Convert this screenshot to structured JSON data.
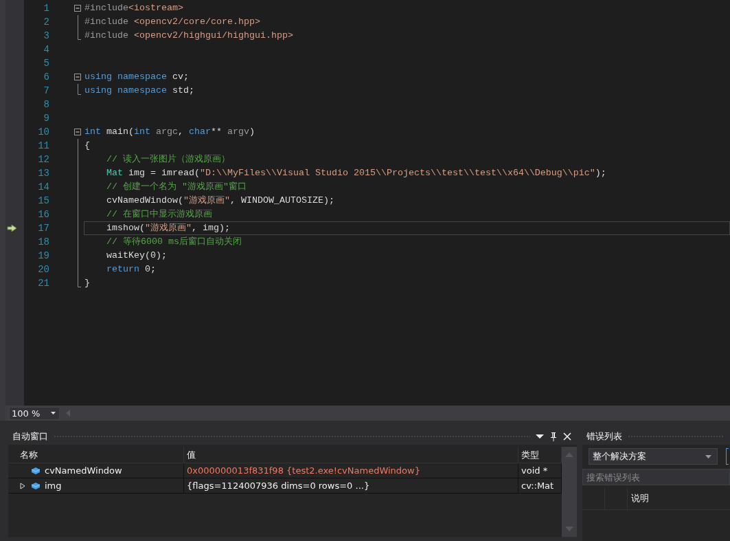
{
  "editor": {
    "lines": [
      {
        "number": "1",
        "kind": "fold_start",
        "current": false,
        "tokens": [
          {
            "kind": "pre",
            "text": "#include"
          },
          {
            "kind": "str",
            "text": "<iostream>"
          }
        ]
      },
      {
        "number": "2",
        "kind": "fold_body",
        "current": false,
        "tokens": [
          {
            "kind": "pre",
            "text": "#include"
          },
          {
            "kind": "str",
            "text": " <opencv2/core/core.hpp>"
          }
        ]
      },
      {
        "number": "3",
        "kind": "fold_end",
        "current": false,
        "tokens": [
          {
            "kind": "pre",
            "text": "#include"
          },
          {
            "kind": "str",
            "text": " <opencv2/highgui/highgui.hpp>"
          }
        ]
      },
      {
        "number": "4",
        "kind": "plain"
      },
      {
        "number": "5",
        "kind": "plain"
      },
      {
        "number": "6",
        "kind": "fold_start",
        "current": false,
        "tokens": [
          {
            "kind": "kw",
            "text": "using"
          },
          {
            "kind": "kw",
            "text": " namespace"
          },
          {
            "kind": "plain",
            "text": " cv;"
          }
        ]
      },
      {
        "number": "7",
        "kind": "fold_end",
        "current": false,
        "tokens": [
          {
            "kind": "kw",
            "text": "using"
          },
          {
            "kind": "kw",
            "text": " namespace"
          },
          {
            "kind": "plain",
            "text": " std;"
          }
        ]
      },
      {
        "number": "8",
        "kind": "plain"
      },
      {
        "number": "9",
        "kind": "plain"
      },
      {
        "number": "10",
        "kind": "fold_start",
        "current": false,
        "tokens": [
          {
            "kind": "kw",
            "text": "int"
          },
          {
            "kind": "plain",
            "text": " main("
          },
          {
            "kind": "kw",
            "text": "int"
          },
          {
            "kind": "param",
            "text": " argc"
          },
          {
            "kind": "plain",
            "text": ", "
          },
          {
            "kind": "kw",
            "text": "char"
          },
          {
            "kind": "plain",
            "text": "**"
          },
          {
            "kind": "param",
            "text": " argv"
          },
          {
            "kind": "plain",
            "text": ")"
          }
        ]
      },
      {
        "number": "11",
        "kind": "fold_body",
        "current": false,
        "tokens": [
          {
            "kind": "plain",
            "text": "{"
          }
        ]
      },
      {
        "number": "12",
        "kind": "fold_body",
        "current": false,
        "tokens": [
          {
            "kind": "cmt",
            "text": "    // 读入一张图片（游戏原画）"
          }
        ]
      },
      {
        "number": "13",
        "kind": "fold_body",
        "current": false,
        "tokens": [
          {
            "kind": "type",
            "text": "    Mat"
          },
          {
            "kind": "plain",
            "text": " img = imread("
          },
          {
            "kind": "str",
            "text": "\"D:\\\\MyFiles\\\\Visual Studio 2015\\\\Projects\\\\test\\\\test\\\\x64\\\\Debug\\\\pic\""
          },
          {
            "kind": "plain",
            "text": ");"
          }
        ]
      },
      {
        "number": "14",
        "kind": "fold_body",
        "current": false,
        "tokens": [
          {
            "kind": "cmt",
            "text": "    // 创建一个名为 \"游戏原画\"窗口"
          }
        ]
      },
      {
        "number": "15",
        "kind": "fold_body",
        "current": false,
        "tokens": [
          {
            "kind": "plain",
            "text": "    cvNamedWindow("
          },
          {
            "kind": "str",
            "text": "\"游戏原画\""
          },
          {
            "kind": "plain",
            "text": ", WINDOW_AUTOSIZE);"
          }
        ]
      },
      {
        "number": "16",
        "kind": "fold_body",
        "current": false,
        "tokens": [
          {
            "kind": "cmt",
            "text": "    // 在窗口中显示游戏原画"
          }
        ]
      },
      {
        "number": "17",
        "kind": "fold_body",
        "current": true,
        "tokens": [
          {
            "kind": "plain",
            "text": "    imshow("
          },
          {
            "kind": "str",
            "text": "\"游戏原画\""
          },
          {
            "kind": "plain",
            "text": ", img);"
          }
        ]
      },
      {
        "number": "18",
        "kind": "fold_body",
        "current": false,
        "tokens": [
          {
            "kind": "cmt",
            "text": "    // 等待6000 ms后窗口自动关闭"
          }
        ]
      },
      {
        "number": "19",
        "kind": "fold_body",
        "current": false,
        "tokens": [
          {
            "kind": "plain",
            "text": "    waitKey(0);"
          }
        ]
      },
      {
        "number": "20",
        "kind": "fold_body",
        "current": false,
        "tokens": [
          {
            "kind": "kw",
            "text": "    return"
          },
          {
            "kind": "plain",
            "text": " 0;"
          }
        ]
      },
      {
        "number": "21",
        "kind": "fold_end",
        "current": false,
        "tokens": [
          {
            "kind": "plain",
            "text": "}"
          }
        ]
      }
    ]
  },
  "zoom": {
    "value": "100 %"
  },
  "autos_panel": {
    "title": "自动窗口",
    "columns": [
      "名称",
      "值",
      "类型"
    ],
    "rows": [
      {
        "name": "cvNamedWindow",
        "value": "0x000000013f831f98 {test2.exe!cvNamedWindow}",
        "type": "void *",
        "expandable": false,
        "changed": true
      },
      {
        "name": "img",
        "value": "{flags=1124007936 dims=0 rows=0 ...}",
        "type": "cv::Mat",
        "expandable": true,
        "changed": false
      }
    ]
  },
  "error_list": {
    "title": "错误列表",
    "scope": "整个解决方案",
    "search": {
      "placeholder": "搜索错误列表"
    },
    "columns": [
      "说明"
    ]
  }
}
